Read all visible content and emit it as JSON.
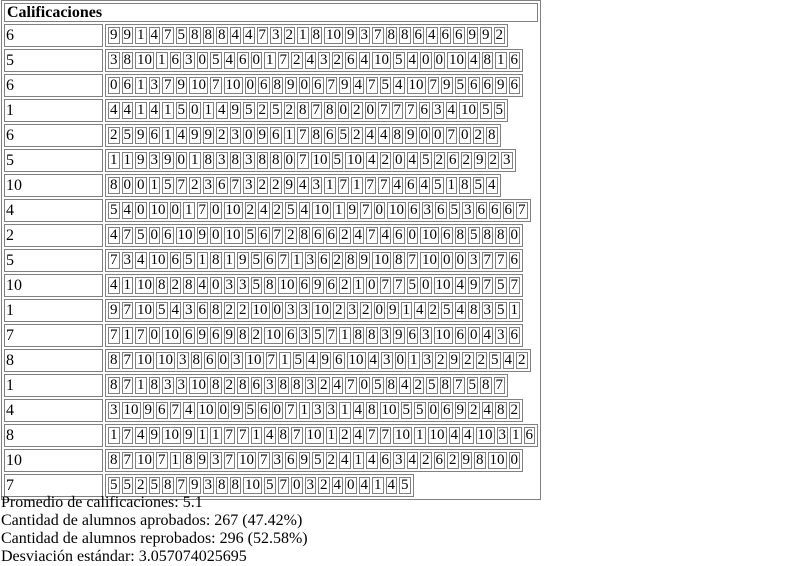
{
  "header": "Calificaciones",
  "rows": [
    {
      "first": "6",
      "scores": [
        "9",
        "9",
        "1",
        "4",
        "7",
        "5",
        "8",
        "8",
        "8",
        "4",
        "4",
        "7",
        "3",
        "2",
        "1",
        "8",
        "10",
        "9",
        "3",
        "7",
        "8",
        "8",
        "6",
        "4",
        "6",
        "6",
        "9",
        "9",
        "2"
      ]
    },
    {
      "first": "5",
      "scores": [
        "3",
        "8",
        "10",
        "1",
        "6",
        "3",
        "0",
        "5",
        "4",
        "6",
        "0",
        "1",
        "7",
        "2",
        "4",
        "3",
        "2",
        "6",
        "4",
        "10",
        "5",
        "4",
        "0",
        "0",
        "10",
        "4",
        "8",
        "1",
        "6"
      ]
    },
    {
      "first": "6",
      "scores": [
        "0",
        "6",
        "1",
        "3",
        "7",
        "9",
        "10",
        "7",
        "10",
        "0",
        "6",
        "8",
        "9",
        "0",
        "6",
        "7",
        "9",
        "4",
        "7",
        "5",
        "4",
        "10",
        "7",
        "9",
        "5",
        "6",
        "6",
        "9",
        "6"
      ]
    },
    {
      "first": "1",
      "scores": [
        "4",
        "4",
        "1",
        "4",
        "1",
        "5",
        "0",
        "1",
        "4",
        "9",
        "5",
        "2",
        "5",
        "2",
        "8",
        "7",
        "8",
        "0",
        "2",
        "0",
        "7",
        "7",
        "7",
        "6",
        "3",
        "4",
        "10",
        "5",
        "5"
      ]
    },
    {
      "first": "6",
      "scores": [
        "2",
        "5",
        "9",
        "6",
        "1",
        "4",
        "9",
        "9",
        "2",
        "3",
        "0",
        "9",
        "6",
        "1",
        "7",
        "8",
        "6",
        "5",
        "2",
        "4",
        "4",
        "8",
        "9",
        "0",
        "0",
        "7",
        "0",
        "2",
        "8"
      ]
    },
    {
      "first": "5",
      "scores": [
        "1",
        "1",
        "9",
        "3",
        "9",
        "0",
        "1",
        "8",
        "3",
        "8",
        "3",
        "8",
        "8",
        "0",
        "7",
        "10",
        "5",
        "10",
        "4",
        "2",
        "0",
        "4",
        "5",
        "2",
        "6",
        "2",
        "9",
        "2",
        "3"
      ]
    },
    {
      "first": "10",
      "scores": [
        "8",
        "0",
        "0",
        "1",
        "5",
        "7",
        "2",
        "3",
        "6",
        "7",
        "3",
        "2",
        "2",
        "9",
        "4",
        "3",
        "1",
        "7",
        "1",
        "7",
        "7",
        "4",
        "6",
        "4",
        "5",
        "1",
        "8",
        "5",
        "4"
      ]
    },
    {
      "first": "4",
      "scores": [
        "5",
        "4",
        "0",
        "10",
        "0",
        "1",
        "7",
        "0",
        "10",
        "2",
        "4",
        "2",
        "5",
        "4",
        "10",
        "1",
        "9",
        "7",
        "0",
        "10",
        "6",
        "3",
        "6",
        "5",
        "3",
        "6",
        "6",
        "6",
        "7"
      ]
    },
    {
      "first": "2",
      "scores": [
        "4",
        "7",
        "5",
        "0",
        "6",
        "10",
        "9",
        "0",
        "10",
        "5",
        "6",
        "7",
        "2",
        "8",
        "6",
        "6",
        "2",
        "4",
        "7",
        "4",
        "6",
        "0",
        "10",
        "6",
        "8",
        "5",
        "8",
        "8",
        "0"
      ]
    },
    {
      "first": "5",
      "scores": [
        "7",
        "3",
        "4",
        "10",
        "6",
        "5",
        "1",
        "8",
        "1",
        "9",
        "5",
        "6",
        "7",
        "1",
        "3",
        "6",
        "2",
        "8",
        "9",
        "10",
        "8",
        "7",
        "10",
        "0",
        "0",
        "3",
        "7",
        "7",
        "6"
      ]
    },
    {
      "first": "10",
      "scores": [
        "4",
        "1",
        "10",
        "8",
        "2",
        "8",
        "4",
        "0",
        "3",
        "3",
        "5",
        "8",
        "10",
        "6",
        "9",
        "6",
        "2",
        "1",
        "0",
        "7",
        "7",
        "5",
        "0",
        "10",
        "4",
        "9",
        "7",
        "5",
        "7"
      ]
    },
    {
      "first": "1",
      "scores": [
        "9",
        "7",
        "10",
        "5",
        "4",
        "3",
        "6",
        "8",
        "2",
        "2",
        "10",
        "0",
        "3",
        "3",
        "10",
        "2",
        "3",
        "2",
        "0",
        "9",
        "1",
        "4",
        "2",
        "5",
        "4",
        "8",
        "3",
        "5",
        "1"
      ]
    },
    {
      "first": "7",
      "scores": [
        "7",
        "1",
        "7",
        "0",
        "10",
        "6",
        "9",
        "6",
        "9",
        "8",
        "2",
        "10",
        "6",
        "3",
        "5",
        "7",
        "1",
        "8",
        "8",
        "3",
        "9",
        "6",
        "3",
        "10",
        "6",
        "0",
        "4",
        "3",
        "6"
      ]
    },
    {
      "first": "8",
      "scores": [
        "8",
        "7",
        "10",
        "10",
        "3",
        "8",
        "6",
        "0",
        "3",
        "10",
        "7",
        "1",
        "5",
        "4",
        "9",
        "6",
        "10",
        "4",
        "3",
        "0",
        "1",
        "3",
        "2",
        "9",
        "2",
        "2",
        "5",
        "4",
        "2"
      ]
    },
    {
      "first": "1",
      "scores": [
        "8",
        "7",
        "1",
        "8",
        "3",
        "3",
        "10",
        "8",
        "2",
        "8",
        "6",
        "3",
        "8",
        "8",
        "3",
        "2",
        "4",
        "7",
        "0",
        "5",
        "8",
        "4",
        "2",
        "5",
        "8",
        "7",
        "5",
        "8",
        "7"
      ]
    },
    {
      "first": "4",
      "scores": [
        "3",
        "10",
        "9",
        "6",
        "7",
        "4",
        "10",
        "0",
        "9",
        "5",
        "6",
        "0",
        "7",
        "1",
        "3",
        "3",
        "1",
        "4",
        "8",
        "10",
        "5",
        "5",
        "0",
        "6",
        "9",
        "2",
        "4",
        "8",
        "2"
      ]
    },
    {
      "first": "8",
      "scores": [
        "1",
        "7",
        "4",
        "9",
        "10",
        "9",
        "1",
        "1",
        "7",
        "7",
        "1",
        "4",
        "8",
        "7",
        "10",
        "1",
        "2",
        "4",
        "7",
        "7",
        "10",
        "1",
        "10",
        "4",
        "4",
        "10",
        "3",
        "1",
        "6"
      ]
    },
    {
      "first": "10",
      "scores": [
        "8",
        "7",
        "10",
        "7",
        "1",
        "8",
        "9",
        "3",
        "7",
        "10",
        "7",
        "3",
        "6",
        "9",
        "5",
        "2",
        "4",
        "1",
        "4",
        "6",
        "3",
        "4",
        "2",
        "6",
        "2",
        "9",
        "8",
        "10",
        "0"
      ]
    },
    {
      "first": "7",
      "scores": [
        "5",
        "5",
        "2",
        "5",
        "8",
        "7",
        "9",
        "3",
        "8",
        "8",
        "10",
        "5",
        "7",
        "0",
        "3",
        "2",
        "4",
        "0",
        "4",
        "1",
        "4",
        "5"
      ]
    }
  ],
  "stats": {
    "average": "Promedio de calificaciones: 5.1",
    "passed": "Cantidad de alumnos aprobados: 267 (47.42%)",
    "failed": "Cantidad de alumnos reprobados: 296 (52.58%)",
    "stddev": "Desviación estándar: 3.057074025695"
  }
}
